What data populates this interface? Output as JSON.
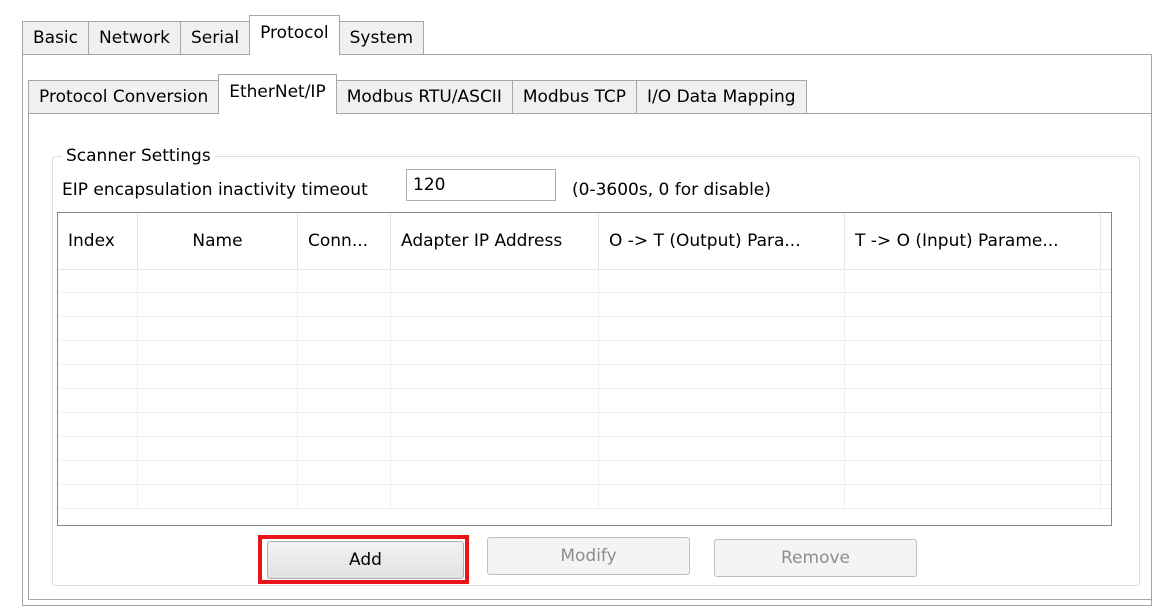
{
  "tabs": {
    "top": [
      "Basic",
      "Network",
      "Serial",
      "Protocol",
      "System"
    ],
    "sub": [
      "Protocol Conversion",
      "EtherNet/IP",
      "Modbus RTU/ASCII",
      "Modbus TCP",
      "I/O Data Mapping"
    ]
  },
  "scanner": {
    "title": "Scanner Settings",
    "timeout_label": "EIP encapsulation inactivity timeout",
    "timeout_value": "120",
    "timeout_hint": "(0-3600s, 0 for disable)"
  },
  "table": {
    "columns": [
      "Index",
      "Name",
      "Conn...",
      "Adapter IP Address",
      "O -> T (Output) Para...",
      "T -> O (Input) Parame..."
    ],
    "rows": []
  },
  "buttons": {
    "add": "Add",
    "modify": "Modify",
    "remove": "Remove"
  },
  "colors": {
    "highlight": "#e8141b"
  }
}
